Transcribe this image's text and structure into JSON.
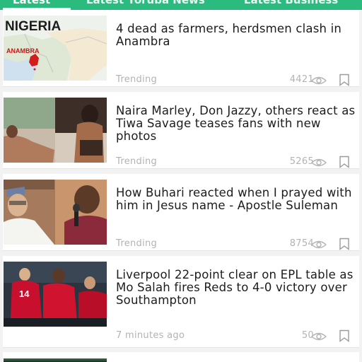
{
  "tabs": [
    {
      "label": "Latest"
    },
    {
      "label": "Latest Yoruba News"
    },
    {
      "label": "Latest Business"
    }
  ],
  "articles": [
    {
      "headline": "4 dead as farmers, herdsmen clash in Anambra",
      "meta": "Trending",
      "views": "4421",
      "map_title": "NIGERIA",
      "map_label": "ANAMBRA"
    },
    {
      "headline": "Naira Marley, Don Jazzy, others react as Tiwa Savage teases fans with new photos",
      "meta": "Trending",
      "views": "5265"
    },
    {
      "headline": "How Buhari reacted when I prayed with him in Jesus name - Apostle Suleman",
      "meta": "Trending",
      "views": "8754"
    },
    {
      "headline": "Liverpool 22-point clear on EPL table as Mo Salah fires Reds to 4-0 victory over Southampton",
      "meta": "7 minutes ago",
      "views": "50"
    }
  ],
  "colors": {
    "accent": "#2bbb7f",
    "meta_text": "#b3b3b3",
    "headline_text": "#1c1c1c"
  },
  "icons": {
    "views": "eye-icon",
    "save": "bookmark-icon"
  }
}
